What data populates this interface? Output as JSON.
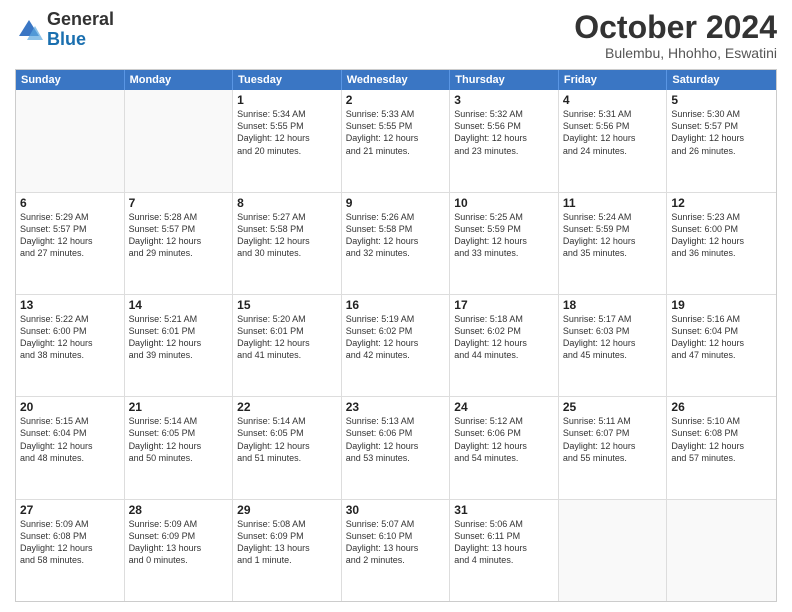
{
  "logo": {
    "general": "General",
    "blue": "Blue"
  },
  "title": "October 2024",
  "location": "Bulembu, Hhohho, Eswatini",
  "days": [
    "Sunday",
    "Monday",
    "Tuesday",
    "Wednesday",
    "Thursday",
    "Friday",
    "Saturday"
  ],
  "weeks": [
    [
      {
        "day": "",
        "info": ""
      },
      {
        "day": "",
        "info": ""
      },
      {
        "day": "1",
        "info": "Sunrise: 5:34 AM\nSunset: 5:55 PM\nDaylight: 12 hours\nand 20 minutes."
      },
      {
        "day": "2",
        "info": "Sunrise: 5:33 AM\nSunset: 5:55 PM\nDaylight: 12 hours\nand 21 minutes."
      },
      {
        "day": "3",
        "info": "Sunrise: 5:32 AM\nSunset: 5:56 PM\nDaylight: 12 hours\nand 23 minutes."
      },
      {
        "day": "4",
        "info": "Sunrise: 5:31 AM\nSunset: 5:56 PM\nDaylight: 12 hours\nand 24 minutes."
      },
      {
        "day": "5",
        "info": "Sunrise: 5:30 AM\nSunset: 5:57 PM\nDaylight: 12 hours\nand 26 minutes."
      }
    ],
    [
      {
        "day": "6",
        "info": "Sunrise: 5:29 AM\nSunset: 5:57 PM\nDaylight: 12 hours\nand 27 minutes."
      },
      {
        "day": "7",
        "info": "Sunrise: 5:28 AM\nSunset: 5:57 PM\nDaylight: 12 hours\nand 29 minutes."
      },
      {
        "day": "8",
        "info": "Sunrise: 5:27 AM\nSunset: 5:58 PM\nDaylight: 12 hours\nand 30 minutes."
      },
      {
        "day": "9",
        "info": "Sunrise: 5:26 AM\nSunset: 5:58 PM\nDaylight: 12 hours\nand 32 minutes."
      },
      {
        "day": "10",
        "info": "Sunrise: 5:25 AM\nSunset: 5:59 PM\nDaylight: 12 hours\nand 33 minutes."
      },
      {
        "day": "11",
        "info": "Sunrise: 5:24 AM\nSunset: 5:59 PM\nDaylight: 12 hours\nand 35 minutes."
      },
      {
        "day": "12",
        "info": "Sunrise: 5:23 AM\nSunset: 6:00 PM\nDaylight: 12 hours\nand 36 minutes."
      }
    ],
    [
      {
        "day": "13",
        "info": "Sunrise: 5:22 AM\nSunset: 6:00 PM\nDaylight: 12 hours\nand 38 minutes."
      },
      {
        "day": "14",
        "info": "Sunrise: 5:21 AM\nSunset: 6:01 PM\nDaylight: 12 hours\nand 39 minutes."
      },
      {
        "day": "15",
        "info": "Sunrise: 5:20 AM\nSunset: 6:01 PM\nDaylight: 12 hours\nand 41 minutes."
      },
      {
        "day": "16",
        "info": "Sunrise: 5:19 AM\nSunset: 6:02 PM\nDaylight: 12 hours\nand 42 minutes."
      },
      {
        "day": "17",
        "info": "Sunrise: 5:18 AM\nSunset: 6:02 PM\nDaylight: 12 hours\nand 44 minutes."
      },
      {
        "day": "18",
        "info": "Sunrise: 5:17 AM\nSunset: 6:03 PM\nDaylight: 12 hours\nand 45 minutes."
      },
      {
        "day": "19",
        "info": "Sunrise: 5:16 AM\nSunset: 6:04 PM\nDaylight: 12 hours\nand 47 minutes."
      }
    ],
    [
      {
        "day": "20",
        "info": "Sunrise: 5:15 AM\nSunset: 6:04 PM\nDaylight: 12 hours\nand 48 minutes."
      },
      {
        "day": "21",
        "info": "Sunrise: 5:14 AM\nSunset: 6:05 PM\nDaylight: 12 hours\nand 50 minutes."
      },
      {
        "day": "22",
        "info": "Sunrise: 5:14 AM\nSunset: 6:05 PM\nDaylight: 12 hours\nand 51 minutes."
      },
      {
        "day": "23",
        "info": "Sunrise: 5:13 AM\nSunset: 6:06 PM\nDaylight: 12 hours\nand 53 minutes."
      },
      {
        "day": "24",
        "info": "Sunrise: 5:12 AM\nSunset: 6:06 PM\nDaylight: 12 hours\nand 54 minutes."
      },
      {
        "day": "25",
        "info": "Sunrise: 5:11 AM\nSunset: 6:07 PM\nDaylight: 12 hours\nand 55 minutes."
      },
      {
        "day": "26",
        "info": "Sunrise: 5:10 AM\nSunset: 6:08 PM\nDaylight: 12 hours\nand 57 minutes."
      }
    ],
    [
      {
        "day": "27",
        "info": "Sunrise: 5:09 AM\nSunset: 6:08 PM\nDaylight: 12 hours\nand 58 minutes."
      },
      {
        "day": "28",
        "info": "Sunrise: 5:09 AM\nSunset: 6:09 PM\nDaylight: 13 hours\nand 0 minutes."
      },
      {
        "day": "29",
        "info": "Sunrise: 5:08 AM\nSunset: 6:09 PM\nDaylight: 13 hours\nand 1 minute."
      },
      {
        "day": "30",
        "info": "Sunrise: 5:07 AM\nSunset: 6:10 PM\nDaylight: 13 hours\nand 2 minutes."
      },
      {
        "day": "31",
        "info": "Sunrise: 5:06 AM\nSunset: 6:11 PM\nDaylight: 13 hours\nand 4 minutes."
      },
      {
        "day": "",
        "info": ""
      },
      {
        "day": "",
        "info": ""
      }
    ]
  ]
}
